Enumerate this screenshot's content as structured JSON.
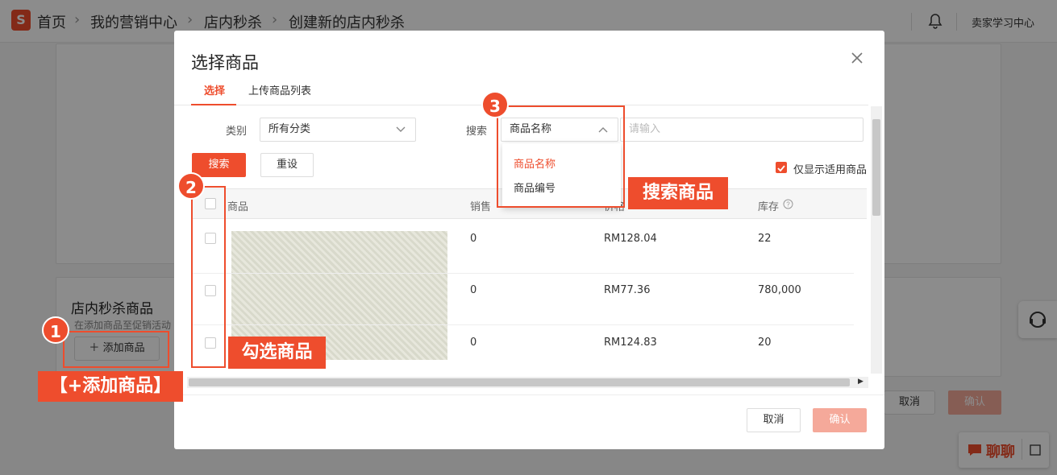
{
  "breadcrumb": {
    "logo": "S",
    "items": [
      "首页",
      "我的营销中心",
      "店内秒杀",
      "创建新的店内秒杀"
    ]
  },
  "topbar": {
    "seller_center": "卖家学习中心"
  },
  "background": {
    "section_title": "店内秒杀商品",
    "section_hint": "在添加商品至促销活动",
    "add_product_button": "添加商品",
    "cancel_button": "取消",
    "confirm_button": "确认"
  },
  "modal": {
    "title": "选择商品",
    "tabs": [
      {
        "label": "选择",
        "active": true
      },
      {
        "label": "上传商品列表",
        "active": false
      }
    ],
    "filters": {
      "category_label": "类别",
      "category_value": "所有分类",
      "search_label": "搜索",
      "search_field_value": "商品名称",
      "search_placeholder": "请输入",
      "search_options": [
        "商品名称",
        "商品编号"
      ]
    },
    "search_button": "搜索",
    "reset_button": "重设",
    "only_applicable": {
      "label": "仅显示适用商品",
      "checked": true
    },
    "table": {
      "headers": [
        "商品",
        "销售",
        "价格",
        "库存"
      ],
      "rows": [
        {
          "sales": "0",
          "price": "RM128.04",
          "stock": "22"
        },
        {
          "sales": "0",
          "price": "RM77.36",
          "stock": "780,000"
        },
        {
          "sales": "0",
          "price": "RM124.83",
          "stock": "20"
        }
      ]
    },
    "cancel_button": "取消",
    "confirm_button": "确认"
  },
  "annotations": {
    "badge1": "1",
    "badge2": "2",
    "badge3": "3",
    "callout1": "【+添加商品】",
    "callout2": "勾选商品",
    "callout3": "搜索商品"
  },
  "chat": {
    "label": "聊聊"
  },
  "colors": {
    "accent": "#ee4d2d",
    "disabled": "#f5a99a"
  }
}
